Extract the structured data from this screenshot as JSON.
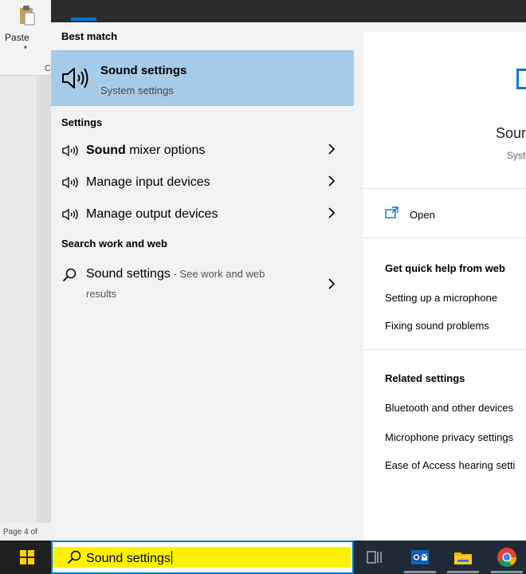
{
  "background_app": {
    "paste_label": "Paste",
    "clip_label": "C",
    "page_status": "Page 4 of"
  },
  "menu": {
    "best_match_header": "Best match",
    "best_match": {
      "title": "Sound settings",
      "subtitle": "System settings",
      "icon": "speaker-icon"
    },
    "settings_header": "Settings",
    "settings_items": [
      {
        "bold": "Sound",
        "rest": " mixer options",
        "icon": "speaker-small-icon"
      },
      {
        "bold": "",
        "rest": "Manage input devices",
        "icon": "speaker-small-icon"
      },
      {
        "bold": "",
        "rest": "Manage output devices",
        "icon": "speaker-small-icon"
      }
    ],
    "web_header": "Search work and web",
    "web_item": {
      "title": "Sound settings",
      "suffix": " - See work and web",
      "line2": "results",
      "icon": "search-icon"
    }
  },
  "detail": {
    "title": "Sour",
    "subtitle": "Syst",
    "open_label": "Open",
    "quick_help_header": "Get quick help from web",
    "quick_help_links": [
      "Setting up a microphone",
      "Fixing sound problems"
    ],
    "related_header": "Related settings",
    "related_links": [
      "Bluetooth and other devices",
      "Microphone privacy settings",
      "Ease of Access hearing setti"
    ]
  },
  "taskbar": {
    "search_text": "Sound settings",
    "apps": [
      "task-view-icon",
      "outlook-icon",
      "file-explorer-icon",
      "chrome-icon"
    ]
  },
  "colors": {
    "accent": "#0078d7",
    "selection": "#a7cce9",
    "highlight": "#fff200",
    "taskbar": "#202a36"
  }
}
